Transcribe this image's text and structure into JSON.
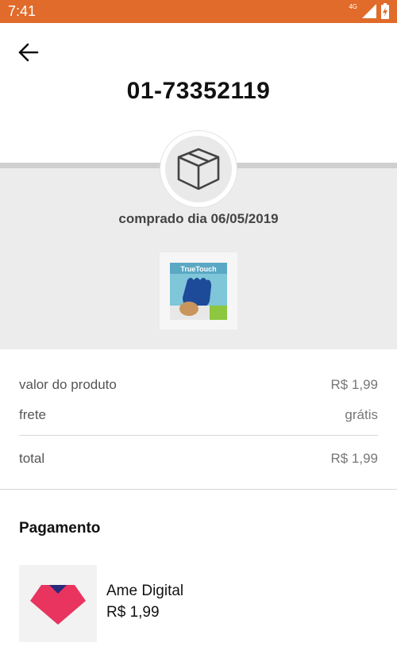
{
  "status_bar": {
    "time": "7:41",
    "network": "4G"
  },
  "order": {
    "number": "01-73352119",
    "purchase_date": "comprado dia 06/05/2019"
  },
  "product": {
    "image_label": "TrueTouch"
  },
  "summary": {
    "product_value_label": "valor do produto",
    "product_value": "R$ 1,99",
    "shipping_label": "frete",
    "shipping_value": "grátis",
    "total_label": "total",
    "total_value": "R$ 1,99"
  },
  "payment": {
    "section_title": "Pagamento",
    "method_name": "Ame Digital",
    "amount": "R$ 1,99"
  },
  "colors": {
    "status_bar": "#e06b2a",
    "ame_pink": "#e8345f",
    "ame_navy": "#2a2a7a"
  },
  "icons": {
    "back": "arrow-left-icon",
    "box": "box-icon",
    "signal": "signal-icon",
    "battery": "battery-icon"
  }
}
